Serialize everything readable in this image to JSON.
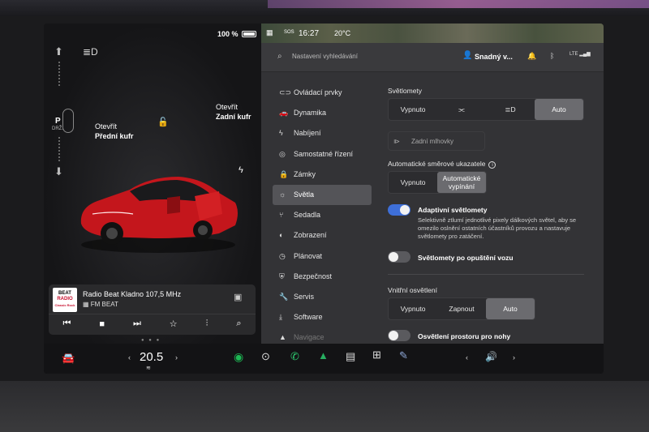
{
  "status": {
    "battery": "100 %",
    "time": "16:27",
    "temp": "20°C",
    "sos": "SOS"
  },
  "left": {
    "gear": "P",
    "gear_sub": "DRŽ.",
    "front_trunk": {
      "line1": "Otevřít",
      "line2": "Přední kufr"
    },
    "rear_trunk": {
      "line1": "Otevřít",
      "line2": "Zadní kufr"
    }
  },
  "media": {
    "station": "Radio Beat Kladno 107,5 MHz",
    "source": "FM BEAT",
    "art_line1": "BEAT",
    "art_line2": "RADIO",
    "art_line3": "Classic Rock"
  },
  "search": {
    "placeholder": "Nastavení vyhledávání"
  },
  "user": {
    "name": "Snadný v..."
  },
  "menu": [
    {
      "label": "Ovládací prvky",
      "icon": "toggle-icon"
    },
    {
      "label": "Dynamika",
      "icon": "car-icon"
    },
    {
      "label": "Nabíjení",
      "icon": "bolt-icon"
    },
    {
      "label": "Samostatné řízení",
      "icon": "steering-wheel-icon"
    },
    {
      "label": "Zámky",
      "icon": "lock-icon"
    },
    {
      "label": "Světla",
      "icon": "sun-icon"
    },
    {
      "label": "Sedadla",
      "icon": "seat-icon"
    },
    {
      "label": "Zobrazení",
      "icon": "display-icon"
    },
    {
      "label": "Plánovat",
      "icon": "clock-icon"
    },
    {
      "label": "Bezpečnost",
      "icon": "shield-icon"
    },
    {
      "label": "Servis",
      "icon": "wrench-icon"
    },
    {
      "label": "Software",
      "icon": "download-icon"
    },
    {
      "label": "Navigace",
      "icon": "navigation-icon"
    }
  ],
  "lights": {
    "headlights_title": "Světlomety",
    "headlights_options": [
      "Vypnuto",
      "",
      "",
      "Auto"
    ],
    "fog_label": "Zadní mlhovky",
    "turn_title": "Automatické směrové ukazatele",
    "turn_options": [
      "Vypnuto",
      "Automatické vypínání"
    ],
    "adaptive_label": "Adaptivní světlomety",
    "adaptive_desc": "Selektivně ztlumí jednotlivé pixely dálkových světel, aby se omezilo oslnění ostatních účastníků provozu a nastavuje světlomety pro zatáčení.",
    "after_exit_label": "Světlomety po opuštění vozu",
    "interior_title": "Vnitřní osvětlení",
    "interior_options": [
      "Vypnuto",
      "Zapnout",
      "Auto"
    ],
    "footwell_label": "Osvětlení prostoru pro nohy"
  },
  "dock": {
    "temperature": "20.5"
  }
}
